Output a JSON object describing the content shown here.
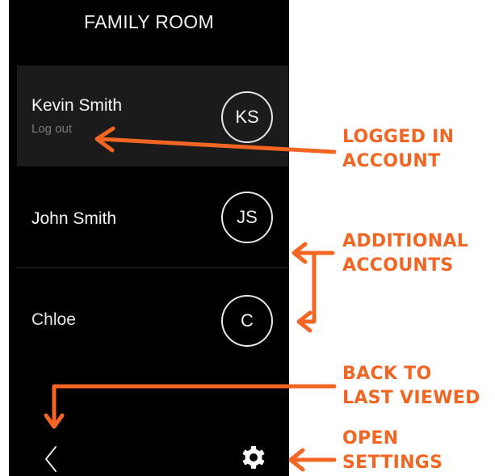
{
  "room": {
    "title": "FAMILY ROOM"
  },
  "accounts": [
    {
      "name": "Kevin Smith",
      "initials": "KS",
      "action": "Log out"
    },
    {
      "name": "John Smith",
      "initials": "JS"
    },
    {
      "name": "Chloe",
      "initials": "C"
    }
  ],
  "nav": {
    "back_icon": "chevron-left-icon",
    "settings_icon": "gear-icon"
  },
  "callouts": {
    "logged_in": {
      "line1": "LOGGED IN",
      "line2": "ACCOUNT"
    },
    "additional": {
      "line1": "ADDITIONAL",
      "line2": "ACCOUNTS"
    },
    "back": {
      "line1": "BACK TO",
      "line2": "LAST VIEWED"
    },
    "settings": {
      "line1": "OPEN",
      "line2": "SETTINGS"
    }
  },
  "colors": {
    "accent": "#f26522",
    "panel": "#000000",
    "selected_row": "#1b1b1b"
  }
}
